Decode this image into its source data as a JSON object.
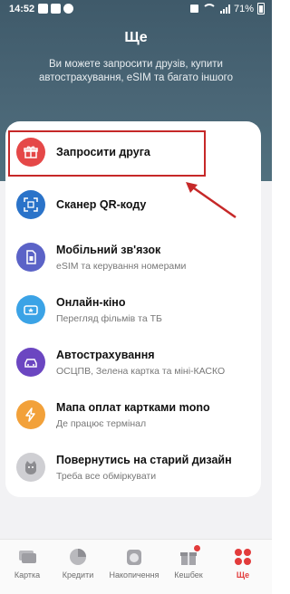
{
  "status": {
    "time": "14:52",
    "battery": "71%"
  },
  "header": {
    "title": "Ще",
    "subtitle": "Ви можете запросити друзів, купити автострахування, eSIM та багато іншого"
  },
  "menu": [
    {
      "title": "Запросити друга",
      "subtitle": "",
      "icon": "gift-icon",
      "color": "#e54848"
    },
    {
      "title": "Сканер QR-коду",
      "subtitle": "",
      "icon": "qr-scanner-icon",
      "color": "#2a73c9"
    },
    {
      "title": "Мобільний зв'язок",
      "subtitle": "eSIM та керування номерами",
      "icon": "sim-card-icon",
      "color": "#5b63c7"
    },
    {
      "title": "Онлайн-кіно",
      "subtitle": "Перегляд фільмів та ТБ",
      "icon": "ticket-icon",
      "color": "#3ba3e6"
    },
    {
      "title": "Автострахування",
      "subtitle": "ОСЦПВ, Зелена картка та міні-КАСКО",
      "icon": "car-shield-icon",
      "color": "#6b46c1"
    },
    {
      "title": "Мапа оплат картками mono",
      "subtitle": "Де працює термінал",
      "icon": "lightning-icon",
      "color": "#f2a13a"
    },
    {
      "title": "Повернутись на старий дизайн",
      "subtitle": "Треба все обміркувати",
      "icon": "cat-face-icon",
      "color": "#cfcfd3"
    }
  ],
  "tabs": [
    {
      "label": "Картка",
      "icon": "cards-icon",
      "active": false
    },
    {
      "label": "Кредити",
      "icon": "pie-chart-icon",
      "active": false
    },
    {
      "label": "Накопичення",
      "icon": "jar-icon",
      "active": false
    },
    {
      "label": "Кешбек",
      "icon": "gift-box-icon",
      "active": false
    },
    {
      "label": "Ще",
      "icon": "four-dots-icon",
      "active": true
    }
  ],
  "colors": {
    "accent": "#e23b3b",
    "header": "#4a6676",
    "highlight_box": "#c62828",
    "arrow": "#c62828"
  }
}
